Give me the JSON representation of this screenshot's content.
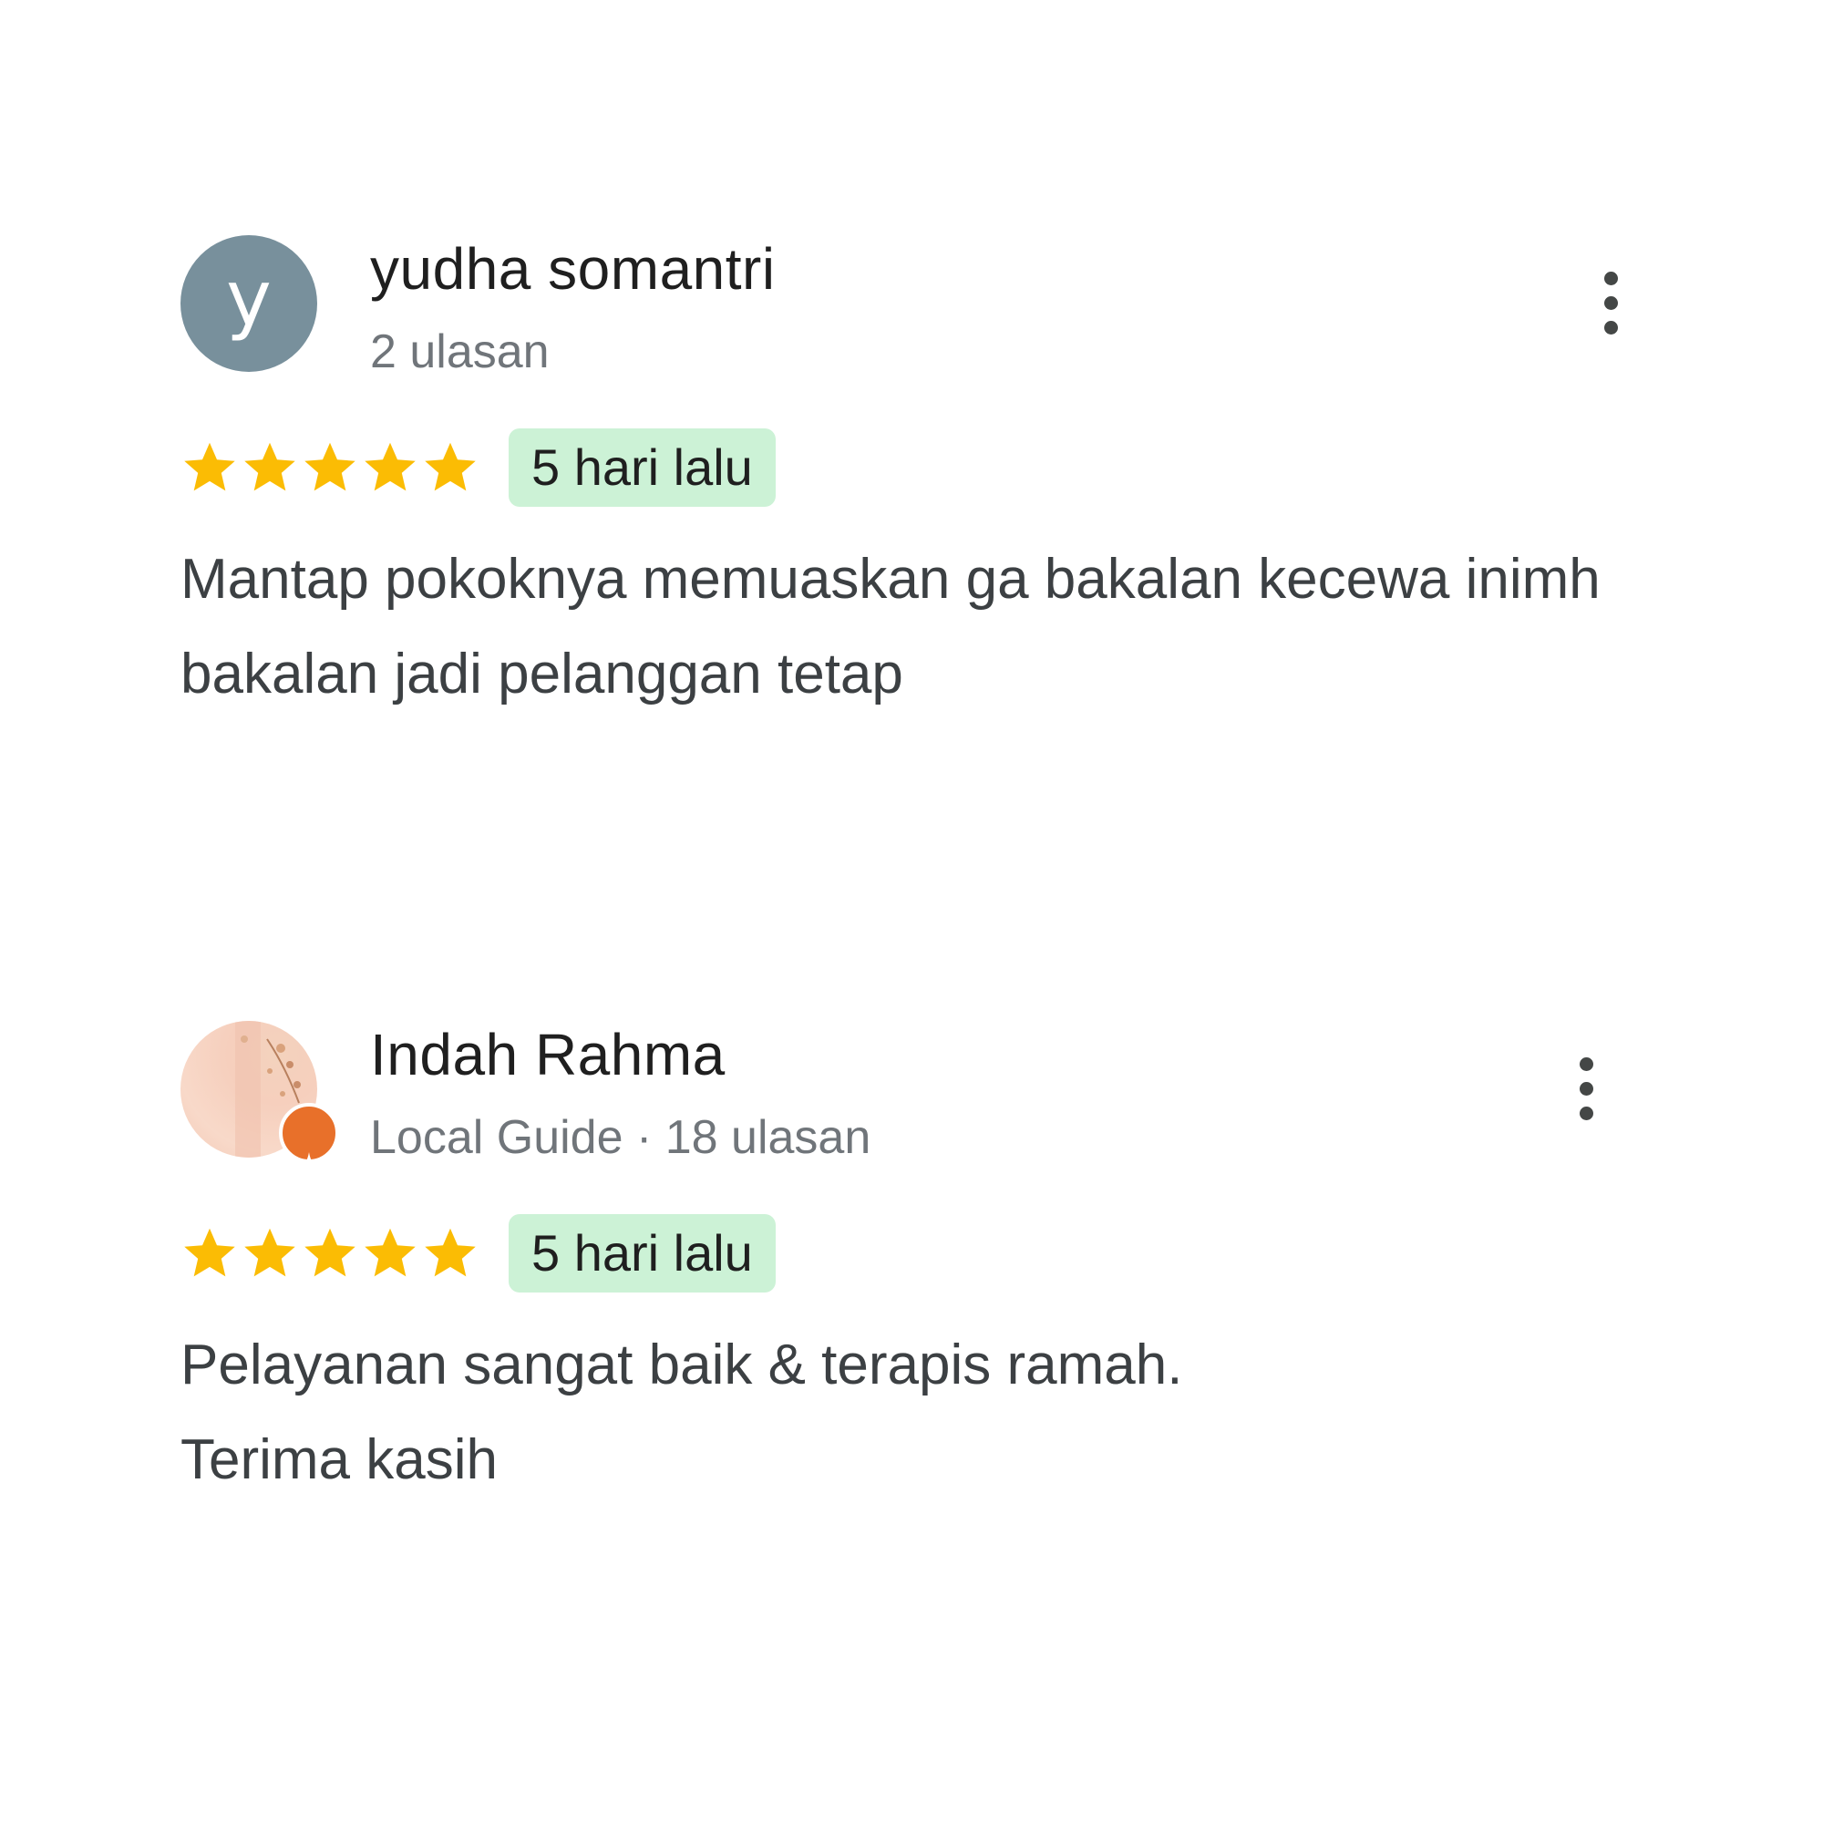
{
  "colors": {
    "star": "#fbbc04",
    "chip_bg": "#ccf2d6",
    "avatar_default": "#78909c",
    "local_guide": "#e8702a"
  },
  "reviews": [
    {
      "avatar_letter": "y",
      "name": "yudha somantri",
      "subline": "2 ulasan",
      "rating": 5,
      "date": "5 hari lalu",
      "text": "Mantap pokoknya memuaskan ga bakalan kecewa inimh bakalan jadi pelanggan tetap"
    },
    {
      "name": "Indah Rahma",
      "subline": "Local Guide · 18 ulasan",
      "rating": 5,
      "date": "5 hari lalu",
      "text_line1": "Pelayanan sangat baik & terapis ramah.",
      "text_line2": "Terima kasih"
    }
  ]
}
